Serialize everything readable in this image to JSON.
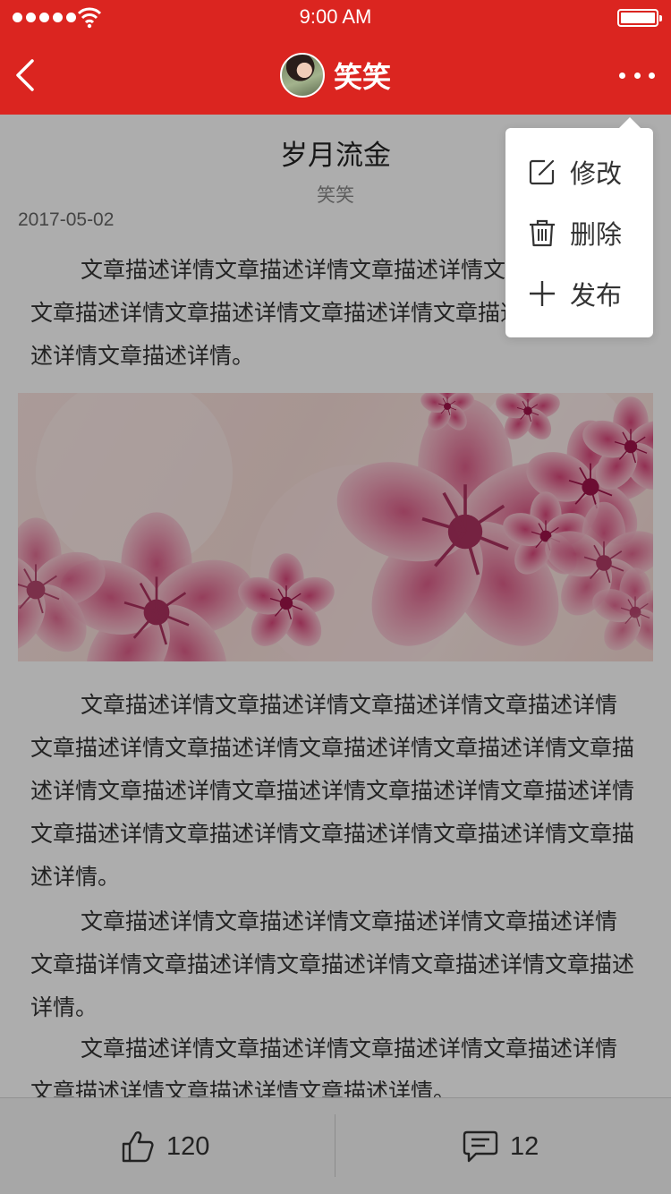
{
  "status_bar": {
    "time": "9:00 AM"
  },
  "nav": {
    "title": "笑笑"
  },
  "article": {
    "title": "岁月流金",
    "author": "笑笑",
    "date": "2017-05-02",
    "paragraphs": [
      "文章描述详情文章描述详情文章描述详情文章描述详情文章描述详情文章描述详情文章描述详情文章描述详情文章描述详情文章描述详情。",
      "文章描述详情文章描述详情文章描述详情文章描述详情文章描述详情文章描述详情文章描述详情文章描述详情文章描述详情文章描述详情文章描述详情文章描述详情文章描述详情文章描述详情文章描述详情文章描述详情文章描述详情文章描述详情。",
      "文章描述详情文章描述详情文章描述详情文章描述详情文章描详情文章描述详情文章描述详情文章描述详情文章描述详情。",
      "文章描述详情文章描述详情文章描述详情文章描述详情文章描述详情文章描述详情文章描述详情。"
    ]
  },
  "menu": {
    "items": [
      {
        "label": "修改",
        "icon": "edit-icon"
      },
      {
        "label": "删除",
        "icon": "trash-icon"
      },
      {
        "label": "发布",
        "icon": "plus-icon"
      }
    ]
  },
  "bottom": {
    "like_count": "120",
    "comment_count": "12"
  },
  "colors": {
    "brand": "#db2520",
    "overlay": "rgba(0,0,0,0.32)"
  }
}
